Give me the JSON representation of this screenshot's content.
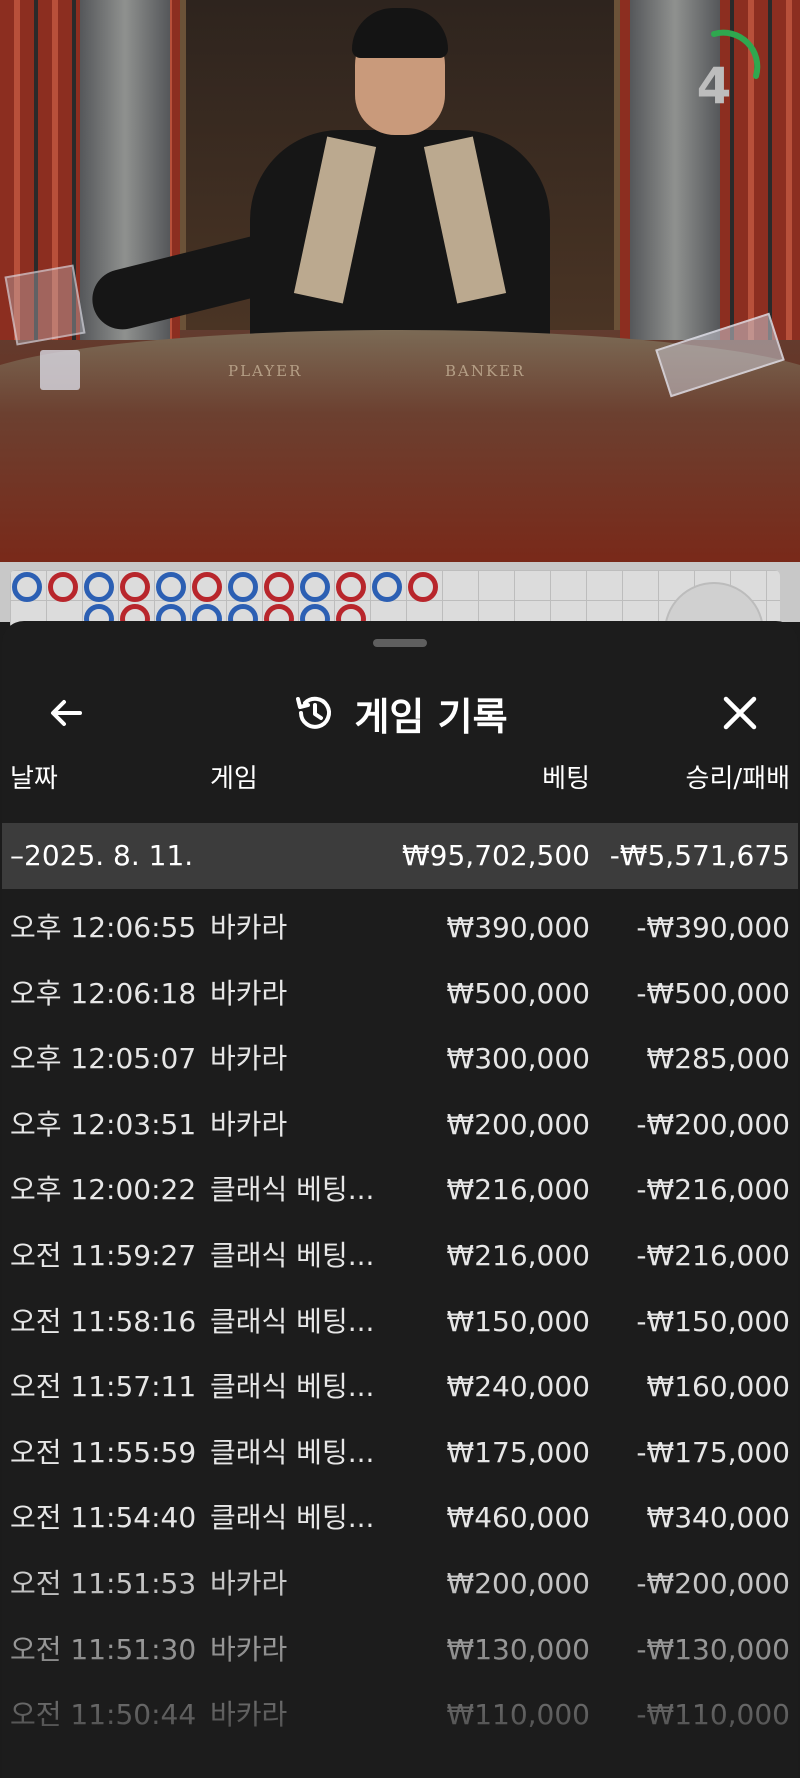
{
  "live": {
    "timer_value": "4",
    "table_player_label": "PLAYER",
    "table_banker_label": "BANKER",
    "timer_color": "#2fa84f"
  },
  "roadmap": {
    "row1": [
      "P",
      "B",
      "P",
      "B",
      "P",
      "B",
      "P",
      "B",
      "P",
      "B",
      "P",
      "B"
    ],
    "colors": {
      "player": "#2c5fb3",
      "banker": "#b8262c"
    }
  },
  "sheet": {
    "title": "게임 기록",
    "title_icon": "history-icon",
    "back_icon": "arrow-left-icon",
    "close_icon": "close-icon",
    "columns": {
      "date": "날짜",
      "game": "게임",
      "bet": "베팅",
      "result": "승리/패배"
    },
    "summary": {
      "date": "–2025. 8. 11.",
      "bet": "₩95,702,500",
      "result": "-₩5,571,675"
    },
    "rows": [
      {
        "time": "오후 12:06:55",
        "game": "바카라",
        "bet": "₩390,000",
        "result": "-₩390,000"
      },
      {
        "time": "오후 12:06:18",
        "game": "바카라",
        "bet": "₩500,000",
        "result": "-₩500,000"
      },
      {
        "time": "오후 12:05:07",
        "game": "바카라",
        "bet": "₩300,000",
        "result": "₩285,000"
      },
      {
        "time": "오후 12:03:51",
        "game": "바카라",
        "bet": "₩200,000",
        "result": "-₩200,000"
      },
      {
        "time": "오후 12:00:22",
        "game": "클래식 베팅...",
        "bet": "₩216,000",
        "result": "-₩216,000"
      },
      {
        "time": "오전 11:59:27",
        "game": "클래식 베팅...",
        "bet": "₩216,000",
        "result": "-₩216,000"
      },
      {
        "time": "오전 11:58:16",
        "game": "클래식 베팅...",
        "bet": "₩150,000",
        "result": "-₩150,000"
      },
      {
        "time": "오전 11:57:11",
        "game": "클래식 베팅...",
        "bet": "₩240,000",
        "result": "₩160,000"
      },
      {
        "time": "오전 11:55:59",
        "game": "클래식 베팅...",
        "bet": "₩175,000",
        "result": "-₩175,000"
      },
      {
        "time": "오전 11:54:40",
        "game": "클래식 베팅...",
        "bet": "₩460,000",
        "result": "₩340,000"
      },
      {
        "time": "오전 11:51:53",
        "game": "바카라",
        "bet": "₩200,000",
        "result": "-₩200,000"
      },
      {
        "time": "오전 11:51:30",
        "game": "바카라",
        "bet": "₩130,000",
        "result": "-₩130,000"
      },
      {
        "time": "오전 11:50:44",
        "game": "바카라",
        "bet": "₩110,000",
        "result": "-₩110,000"
      }
    ]
  }
}
